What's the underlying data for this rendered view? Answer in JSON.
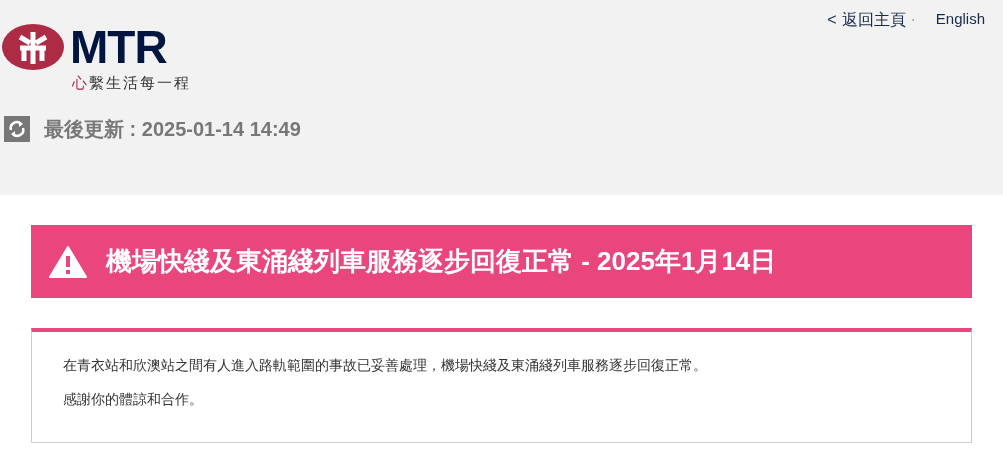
{
  "header": {
    "logo": {
      "wordmark": "MTR",
      "slogan_accent": "心",
      "slogan_rest": "繫生活每一程"
    },
    "nav": {
      "back_arrow": "<",
      "back_link": "返回主頁",
      "separator": "·",
      "language_link": "English"
    },
    "last_updated": "最後更新 : 2025-01-14 14:49"
  },
  "alert": {
    "title": "機場快綫及東涌綫列車服務逐步回復正常 - 2025年1月14日"
  },
  "message": {
    "paragraphs": [
      "在青衣站和欣澳站之間有人進入路軌範圍的事故已妥善處理，機場快綫及東涌綫列車服務逐步回復正常。",
      "感謝你的體諒和合作。"
    ]
  }
}
